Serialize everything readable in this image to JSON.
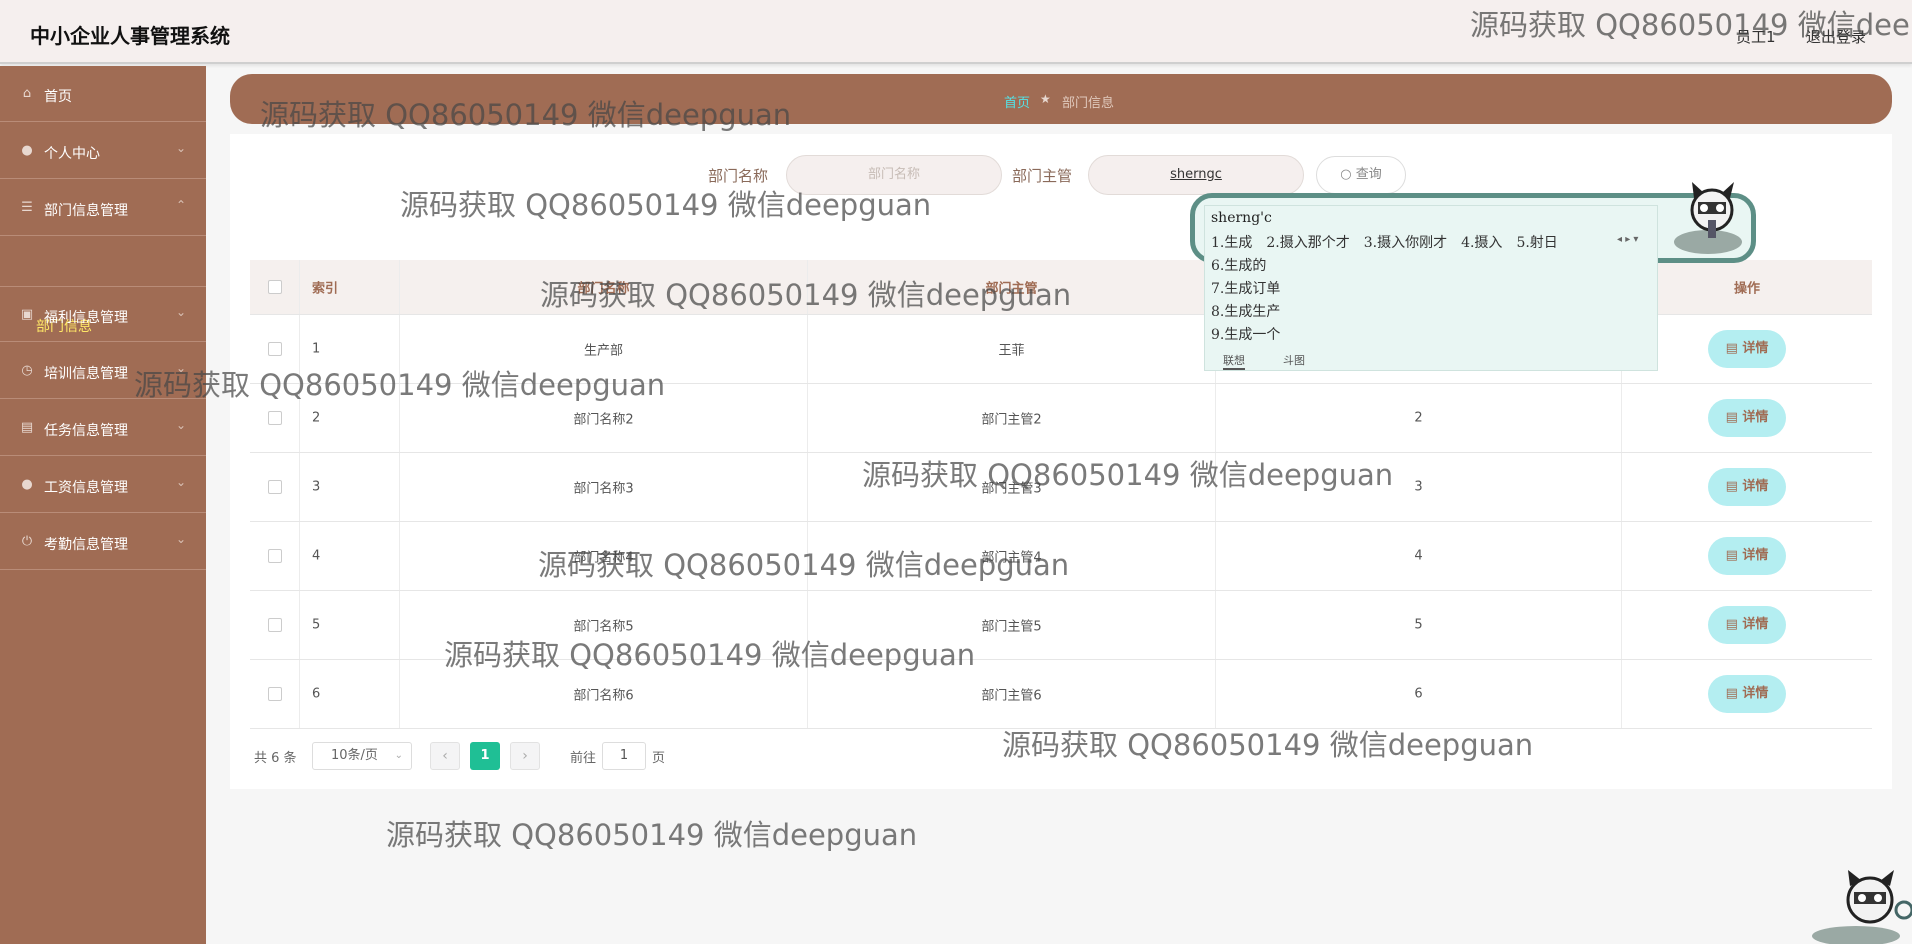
{
  "app": {
    "title": "中小企业人事管理系统"
  },
  "header": {
    "user": "员工1",
    "logout": "退出登录"
  },
  "sidebar": {
    "items": [
      {
        "label": "首页",
        "icon": "home-icon"
      },
      {
        "label": "个人中心",
        "icon": "user-icon"
      },
      {
        "label": "部门信息管理",
        "icon": "list-icon",
        "expanded": true
      },
      {
        "label": "福利信息管理",
        "icon": "gift-icon"
      },
      {
        "label": "培训信息管理",
        "icon": "clock-icon"
      },
      {
        "label": "任务信息管理",
        "icon": "clipboard-icon"
      },
      {
        "label": "工资信息管理",
        "icon": "user-icon"
      },
      {
        "label": "考勤信息管理",
        "icon": "power-icon"
      }
    ],
    "active_sub": "部门信息"
  },
  "breadcrumb": {
    "home": "首页",
    "current": "部门信息"
  },
  "filter": {
    "dept_name_label": "部门名称",
    "dept_name_placeholder": "部门名称",
    "manager_label": "部门主管",
    "manager_value": "sherngc",
    "query_label": "查询"
  },
  "table": {
    "headers": [
      "索引",
      "部门名称",
      "部门主管",
      "",
      "操作"
    ],
    "rows": [
      {
        "index": "1",
        "name": "生产部",
        "manager": "王菲",
        "count": ""
      },
      {
        "index": "2",
        "name": "部门名称2",
        "manager": "部门主管2",
        "count": "2"
      },
      {
        "index": "3",
        "name": "部门名称3",
        "manager": "部门主管3",
        "count": "3"
      },
      {
        "index": "4",
        "name": "部门名称4",
        "manager": "部门主管4",
        "count": "4"
      },
      {
        "index": "5",
        "name": "部门名称5",
        "manager": "部门主管5",
        "count": "5"
      },
      {
        "index": "6",
        "name": "部门名称6",
        "manager": "部门主管6",
        "count": "6"
      }
    ],
    "detail_label": "详情"
  },
  "pagination": {
    "total": "共 6 条",
    "page_size": "10条/页",
    "current": "1",
    "goto_label": "前往",
    "goto_value": "1",
    "page_suffix": "页"
  },
  "ime": {
    "composition": "sherng'c",
    "line1": [
      "1.生成",
      "2.摄入那个才",
      "3.摄入你刚才",
      "4.摄入",
      "5.射日"
    ],
    "candidates": [
      "6.生成的",
      "7.生成订单",
      "8.生成生产",
      "9.生成一个"
    ],
    "tabs": [
      "联想",
      "斗图"
    ]
  },
  "watermark": "源码获取 QQ86050149 微信deepguan",
  "watermark_top": "源码获取 QQ86050149 微信dee",
  "colors": {
    "sidebar_bg": "#a06c54",
    "accent_cyan": "#55e2e6",
    "sub_active": "#ffe766",
    "page_active": "#1fbf95",
    "detail_btn_bg": "#b4eef1"
  }
}
